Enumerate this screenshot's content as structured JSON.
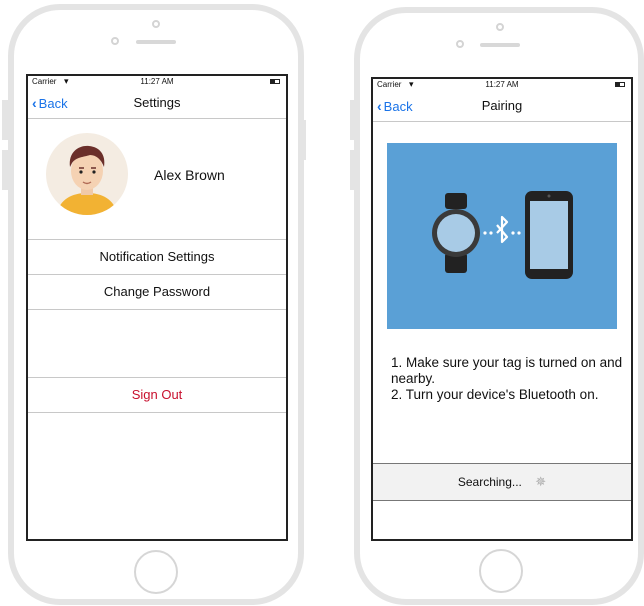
{
  "settings_screen": {
    "status": {
      "carrier": "Carrier",
      "time": "11:27 AM"
    },
    "nav": {
      "back_label": "Back",
      "title": "Settings"
    },
    "profile": {
      "name": "Alex Brown"
    },
    "menu": [
      {
        "label": "Notification Settings"
      },
      {
        "label": "Change Password"
      }
    ],
    "sign_out_label": "Sign Out",
    "sign_out_color": "#c8102e"
  },
  "pairing_screen": {
    "status": {
      "carrier": "Carrier",
      "time": "11:27 AM"
    },
    "nav": {
      "back_label": "Back",
      "title": "Pairing"
    },
    "illustration_color": "#5aa0d6",
    "instructions": {
      "line1": "1. Make sure your tag is turned on and nearby.",
      "line2": "2. Turn your device's Bluetooth on."
    },
    "searching_label": "Searching..."
  },
  "colors": {
    "accent": "#1a73e8"
  }
}
